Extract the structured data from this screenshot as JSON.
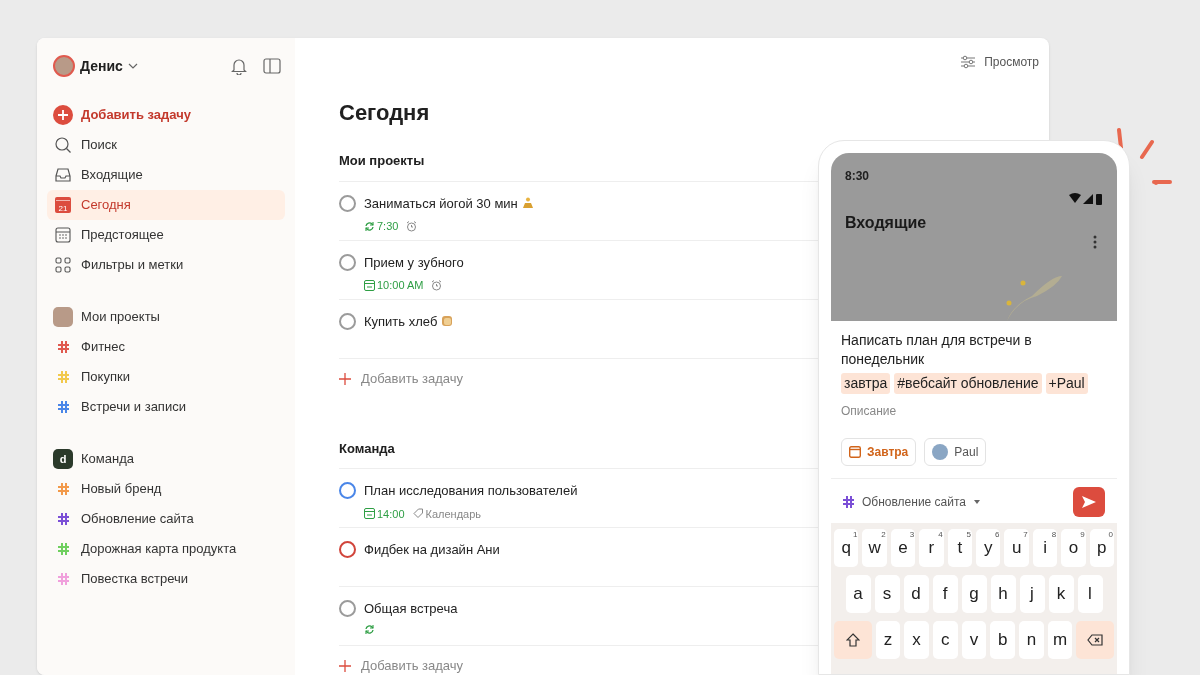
{
  "sidebar": {
    "user": {
      "name": "Денис"
    },
    "nav": [
      {
        "kind": "add",
        "label": "Добавить задачу",
        "selected": false
      },
      {
        "kind": "search",
        "label": "Поиск",
        "selected": false
      },
      {
        "kind": "inbox",
        "label": "Входящие",
        "selected": false
      },
      {
        "kind": "today",
        "label": "Сегодня",
        "selected": true,
        "badge": "21"
      },
      {
        "kind": "upcoming",
        "label": "Предстоящее",
        "selected": false
      },
      {
        "kind": "filters",
        "label": "Фильтры и метки",
        "selected": false
      }
    ],
    "groups": [
      {
        "kind": "personal",
        "label": "Мои проекты",
        "projects": [
          {
            "label": "Фитнес",
            "color": "#e05a4f"
          },
          {
            "label": "Покупки",
            "color": "#f2c94c"
          },
          {
            "label": "Встречи и записи",
            "color": "#4a86e8"
          }
        ]
      },
      {
        "kind": "team",
        "label": "Команда",
        "avatar_letter": "d",
        "projects": [
          {
            "label": "Новый бренд",
            "color": "#f2994a"
          },
          {
            "label": "Обновление сайта",
            "color": "#7b4fd6"
          },
          {
            "label": "Дорожная карта продукта",
            "color": "#6fcf5f"
          },
          {
            "label": "Повестка встречи",
            "color": "#f0a0dc"
          }
        ]
      }
    ]
  },
  "main": {
    "view_button": "Просмотр",
    "title": "Сегодня",
    "sections": [
      {
        "title": "Мои проекты",
        "add_label": "Добавить задачу",
        "tasks": [
          {
            "title": "Заниматься йогой 30 мин",
            "kind": "yoga",
            "color": "#9b9b9b",
            "meta": [
              {
                "kind": "recurring",
                "text": "7:30"
              },
              {
                "kind": "alarm"
              }
            ]
          },
          {
            "title": "Прием у зубного",
            "kind": "plain",
            "color": "#9b9b9b",
            "meta": [
              {
                "kind": "date",
                "text": "10:00 AM"
              },
              {
                "kind": "alarm"
              }
            ]
          },
          {
            "title": "Купить хлеб",
            "kind": "bread",
            "color": "#9b9b9b"
          }
        ]
      },
      {
        "title": "Команда",
        "add_label": "Добавить задачу",
        "tasks": [
          {
            "title": "План исследования пользователей",
            "kind": "plain",
            "color": "#4a86e8",
            "meta": [
              {
                "kind": "date",
                "text": "14:00"
              },
              {
                "kind": "label",
                "text": "Календарь"
              }
            ]
          },
          {
            "title": "Фидбек на дизайн Ани",
            "kind": "plain",
            "color": "#d1453b"
          },
          {
            "title": "Общая встреча",
            "kind": "plain",
            "color": "#9b9b9b",
            "meta": [
              {
                "kind": "recurring"
              }
            ]
          }
        ]
      }
    ]
  },
  "phone": {
    "time": "8:30",
    "title": "Входящие",
    "task": "Написать план для встречи в понедельник",
    "tokens": [
      "завтра",
      "#вебсайт обновление",
      "+Paul"
    ],
    "description_placeholder": "Описание",
    "chips": [
      {
        "kind": "date",
        "label": "Завтра"
      },
      {
        "kind": "person",
        "label": "Paul"
      }
    ],
    "project": "Обновление сайта",
    "keyboard": [
      [
        {
          "key": "q",
          "hint": "1"
        },
        {
          "key": "w",
          "hint": "2"
        },
        {
          "key": "e",
          "hint": "3"
        },
        {
          "key": "r",
          "hint": "4"
        },
        {
          "key": "t",
          "hint": "5"
        },
        {
          "key": "y",
          "hint": "6"
        },
        {
          "key": "u",
          "hint": "7"
        },
        {
          "key": "i",
          "hint": "8"
        },
        {
          "key": "o",
          "hint": "9"
        },
        {
          "key": "p",
          "hint": "0"
        }
      ],
      [
        {
          "key": "a"
        },
        {
          "key": "s"
        },
        {
          "key": "d"
        },
        {
          "key": "f"
        },
        {
          "key": "g"
        },
        {
          "key": "h"
        },
        {
          "key": "j"
        },
        {
          "key": "k"
        },
        {
          "key": "l"
        }
      ],
      [
        {
          "kind": "shift"
        },
        {
          "key": "z"
        },
        {
          "key": "x"
        },
        {
          "key": "c"
        },
        {
          "key": "v"
        },
        {
          "key": "b"
        },
        {
          "key": "n"
        },
        {
          "key": "m"
        },
        {
          "kind": "backspace"
        }
      ]
    ]
  }
}
